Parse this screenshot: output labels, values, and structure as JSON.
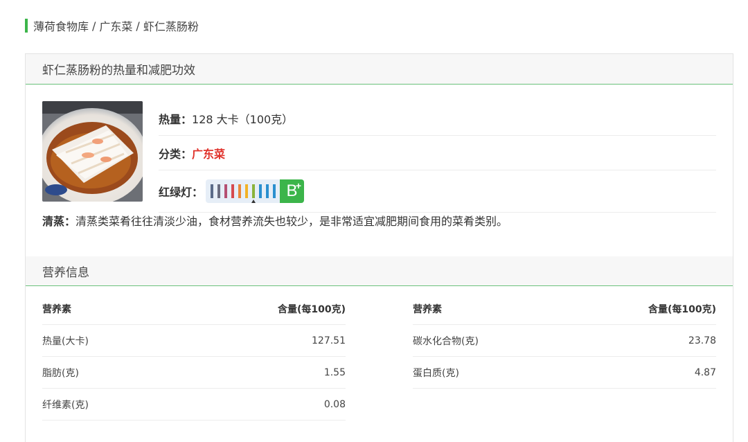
{
  "breadcrumb": {
    "items": [
      "薄荷食物库",
      "广东菜",
      "虾仁蒸肠粉"
    ],
    "separator": "/"
  },
  "summary": {
    "title": "虾仁蒸肠粉的热量和减肥功效",
    "calorie_label": "热量：",
    "calorie_value": "128 大卡（100克）",
    "category_label": "分类：",
    "category_value": "广东菜",
    "light_label": "红绿灯：",
    "light_grade": "B",
    "light_grade_sup": "+",
    "light_bars": [
      "#5a6b89",
      "#6a6d80",
      "#b44f72",
      "#d64a4f",
      "#e9873a",
      "#f2b226",
      "#8ab33b",
      "#2a8fcf",
      "#2a8fcf",
      "#2a8fcf"
    ],
    "light_marker_index": 6,
    "image_icon": "food-photo-icon"
  },
  "method": {
    "label": "清蒸：",
    "text": "清蒸类菜肴往往清淡少油，食材营养流失也较少，是非常适宜减肥期间食用的菜肴类别。"
  },
  "nutrition": {
    "title": "营养信息",
    "header": {
      "nutrient": "营养素",
      "amount": "含量(每100克)"
    },
    "left": [
      {
        "name": "热量(大卡)",
        "value": "127.51"
      },
      {
        "name": "脂肪(克)",
        "value": "1.55"
      },
      {
        "name": "纤维素(克)",
        "value": "0.08"
      }
    ],
    "right": [
      {
        "name": "碳水化合物(克)",
        "value": "23.78"
      },
      {
        "name": "蛋白质(克)",
        "value": "4.87"
      }
    ]
  },
  "colors": {
    "accent": "#3cb54a",
    "category": "#e0322b",
    "panel_head_bg": "#f7f7f7"
  }
}
